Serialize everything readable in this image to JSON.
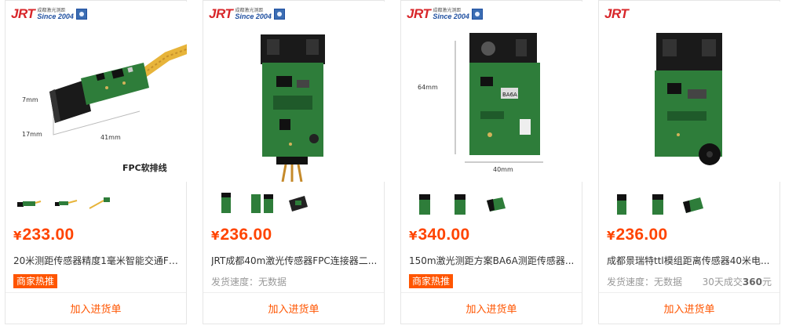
{
  "logo": {
    "brand": "JRT",
    "since": "Since 2004",
    "cn": "成都激光测距"
  },
  "products": [
    {
      "currency": "¥",
      "price": "233.00",
      "title": "20米测距传感器精度1毫米智能交通FPC...",
      "hot_tag": "商家热推",
      "ship": "",
      "sold_prefix": "",
      "sold_count": "",
      "sold_suffix": "",
      "dims": {
        "h": "7mm",
        "d": "17mm",
        "w": "41mm"
      },
      "caption": "FPC软排线",
      "add_btn": "加入进货单"
    },
    {
      "currency": "¥",
      "price": "236.00",
      "title": "JRT成都40m激光传感器FPC连接器二...",
      "hot_tag": "",
      "ship": "发货速度：无数据",
      "sold_prefix": "",
      "sold_count": "",
      "sold_suffix": "",
      "add_btn": "加入进货单"
    },
    {
      "currency": "¥",
      "price": "340.00",
      "title": "150m激光测距方案BA6A测距传感器...",
      "hot_tag": "商家热推",
      "ship": "",
      "sold_prefix": "",
      "sold_count": "",
      "sold_suffix": "",
      "dims": {
        "h": "64mm",
        "w": "40mm"
      },
      "chip_label": "BA6A",
      "add_btn": "加入进货单"
    },
    {
      "currency": "¥",
      "price": "236.00",
      "title": "成都景瑞特ttl模组距离传感器40米电...",
      "hot_tag": "",
      "ship": "发货速度：无数据",
      "sold_prefix": "30天成交",
      "sold_count": "360",
      "sold_suffix": "元",
      "add_btn": "加入进货单"
    }
  ],
  "colors": {
    "price": "#ff4400",
    "tag_bg": "#ff5500",
    "brand_red": "#d8262a",
    "pcb_green": "#2e7d3a"
  }
}
